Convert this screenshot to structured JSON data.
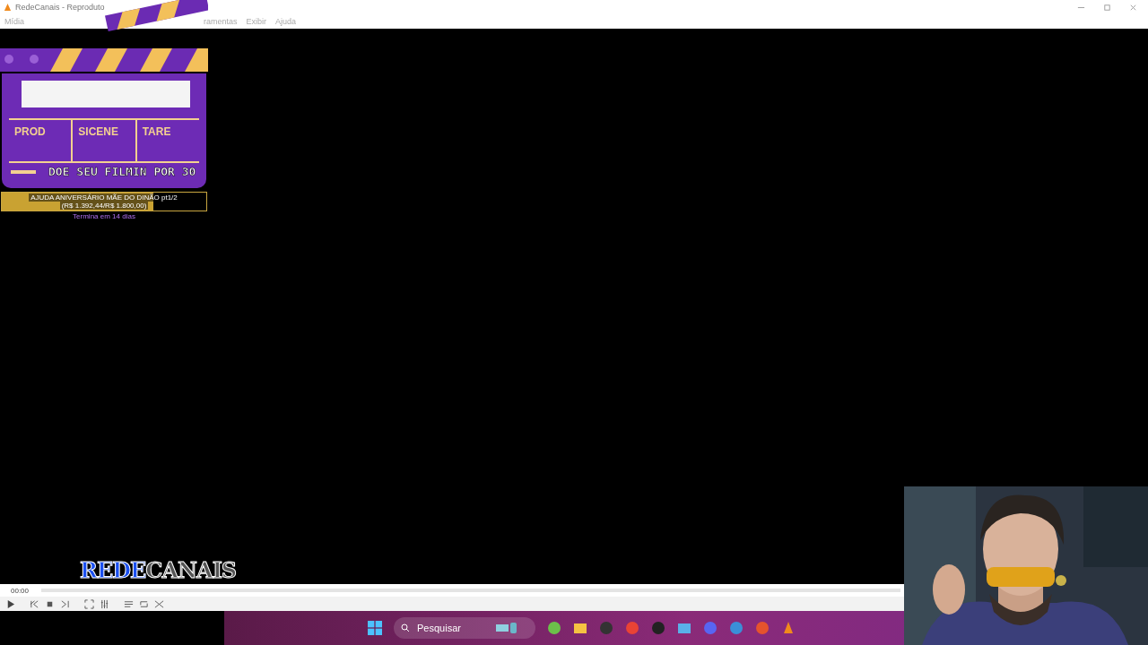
{
  "window": {
    "title": "RedeCanais - Reproduto"
  },
  "menu": [
    "Mídia",
    "ramentas",
    "Exibir",
    "Ajuda"
  ],
  "clapperboard": {
    "columns": [
      "PROD",
      "SICENE",
      "TARE"
    ],
    "caption": "DOE SEU FILMIN POR 30"
  },
  "goal": {
    "title": "AJUDA ANIVERSÁRIO MÃE DO DINÃO pt1/2",
    "amount": "(R$ 1.392,44/R$ 1.800,00)",
    "level": 0.74,
    "deadline": "Termina em 14 dias"
  },
  "logo": [
    "REDE",
    "CANAIS"
  ],
  "player": {
    "time": "00:00"
  },
  "taskbar": {
    "search": {
      "placeholder": "Pesquisar"
    }
  },
  "webcam": {
    "kind": "picture"
  }
}
